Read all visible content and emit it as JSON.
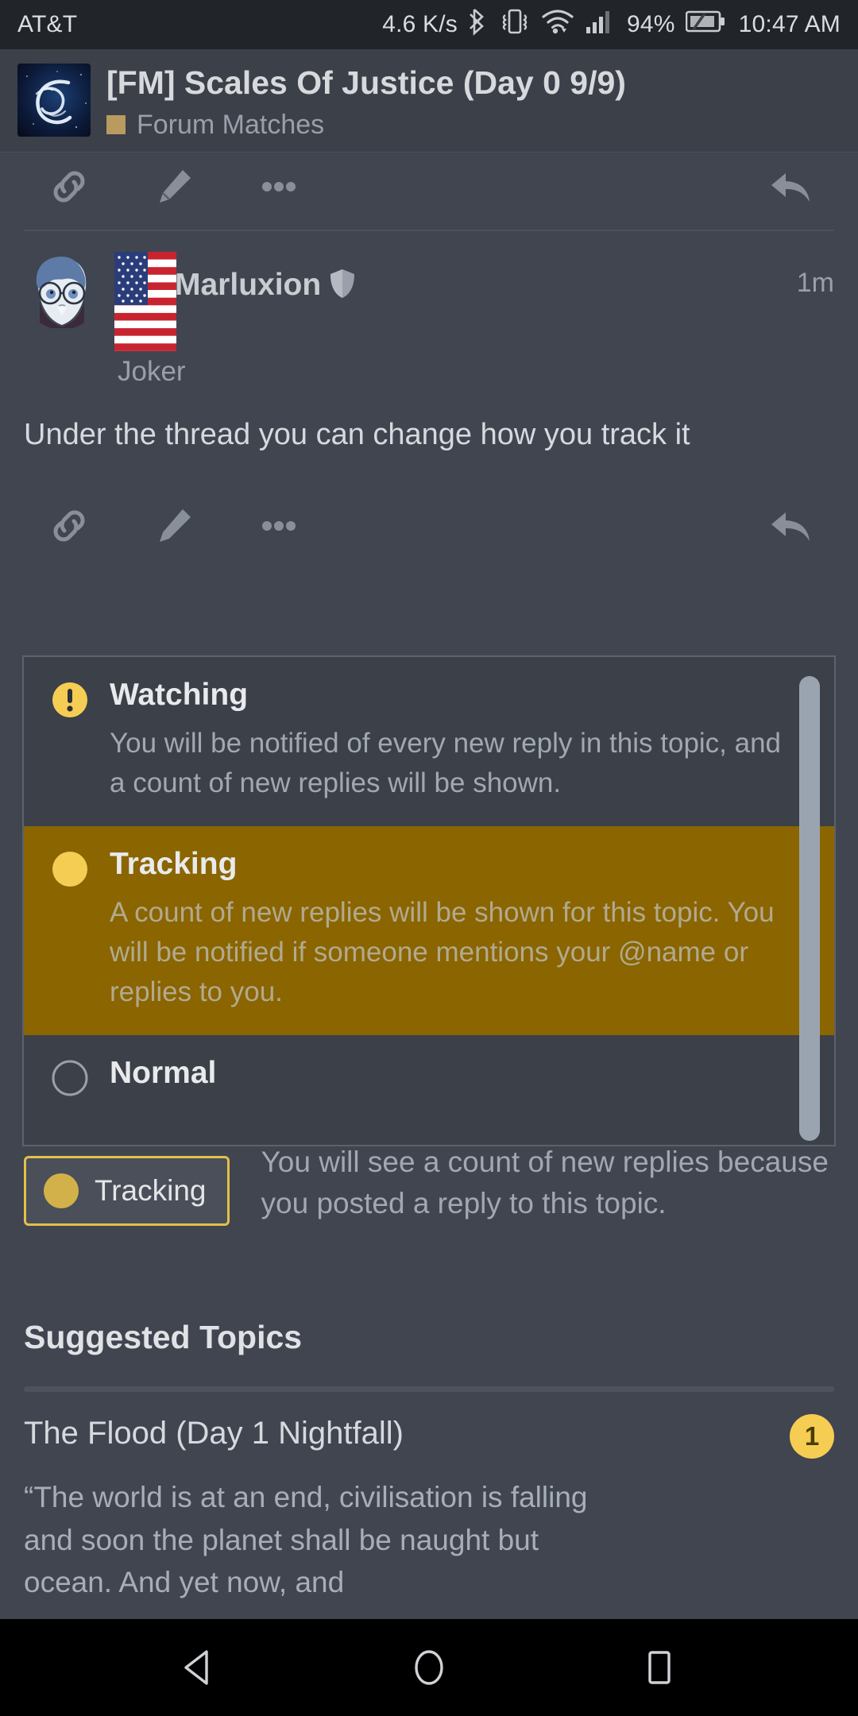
{
  "status_bar": {
    "carrier": "AT&T",
    "network_speed": "4.6 K/s",
    "icons": [
      "bluetooth-icon",
      "vibrate-icon",
      "wifi-icon",
      "cellular-signal-icon"
    ],
    "battery_percent": "94%",
    "clock": "10:47 AM"
  },
  "topic_header": {
    "avatar": "topic-avatar-galaxy-swirl",
    "title": "[FM] Scales Of Justice (Day 0 9/9)",
    "category": "Forum Matches",
    "category_color": "#b99a5f"
  },
  "top_actions": {
    "link_label": "link-icon",
    "edit_label": "pencil-icon",
    "more_label": "ellipsis-icon",
    "reply_label": "reply-arrow-icon"
  },
  "post": {
    "avatar": "user-avatar-joker",
    "flag": "flag-united-states",
    "username": "Marluxion",
    "badge": "shield-icon",
    "user_title": "Joker",
    "time_ago": "1m",
    "body": "Under the thread you can change how you track it"
  },
  "subscribe_dropdown": {
    "options": [
      {
        "id": "watching",
        "title": "Watching",
        "description": "You will be notified of every new reply in this topic, and a count of new replies will be shown.",
        "icon": "exclamation-circle-icon",
        "icon_color": "#f5cd52",
        "selected": false
      },
      {
        "id": "tracking",
        "title": "Tracking",
        "description": "A count of new replies will be shown for this topic. You will be notified if someone mentions your @name or replies to you.",
        "icon": "filled-circle-icon",
        "icon_color": "#f5cd52",
        "selected": true
      },
      {
        "id": "normal",
        "title": "Normal",
        "description": "",
        "icon": "empty-circle-icon",
        "icon_color": "#9aa0aa",
        "selected": false
      }
    ],
    "highlight_color": "#8a6500"
  },
  "tracking_status": {
    "button_label": "Tracking",
    "button_border_color": "#e2c04a",
    "status_text": "You will see a count of new replies because you posted a reply to this topic."
  },
  "suggested": {
    "heading": "Suggested Topics",
    "items": [
      {
        "title": "The Flood (Day 1 Nightfall)",
        "badge": "1",
        "excerpt": "“The world is at an end, civilisation is falling and soon the planet shall be naught but ocean. And yet now, and"
      }
    ]
  },
  "nav_bar": {
    "back": "back-triangle-icon",
    "home": "home-circle-icon",
    "recents": "recents-square-icon"
  }
}
